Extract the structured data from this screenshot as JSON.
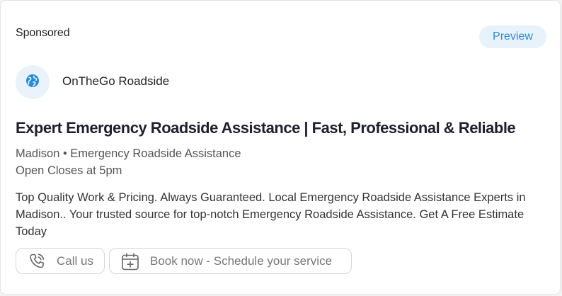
{
  "ad": {
    "sponsored_label": "Sponsored",
    "preview_label": "Preview",
    "advertiser_name": "OnTheGo Roadside",
    "advertiser_icon": "globe-icon",
    "headline": "Expert Emergency Roadside Assistance | Fast, Professional & Reliable",
    "location_line": "Madison • Emergency Roadside Assistance",
    "hours_line": "Open Closes at 5pm",
    "description": "Top Quality Work & Pricing. Always Guaranteed. Local Emergency Roadside Assistance Experts in Madison.. Your trusted source for top-notch Emergency Roadside Assistance. Get A Free Estimate Today"
  },
  "actions": {
    "call_label": "Call us",
    "call_icon": "phone-icon",
    "book_label": "Book now - Schedule your service",
    "book_icon": "calendar-add-icon"
  },
  "colors": {
    "accent": "#2a8bd4",
    "preview_bg": "#e8f2fb",
    "globe_bg": "#eaf3fb",
    "headline": "#1f1f2e",
    "muted": "#555555"
  }
}
